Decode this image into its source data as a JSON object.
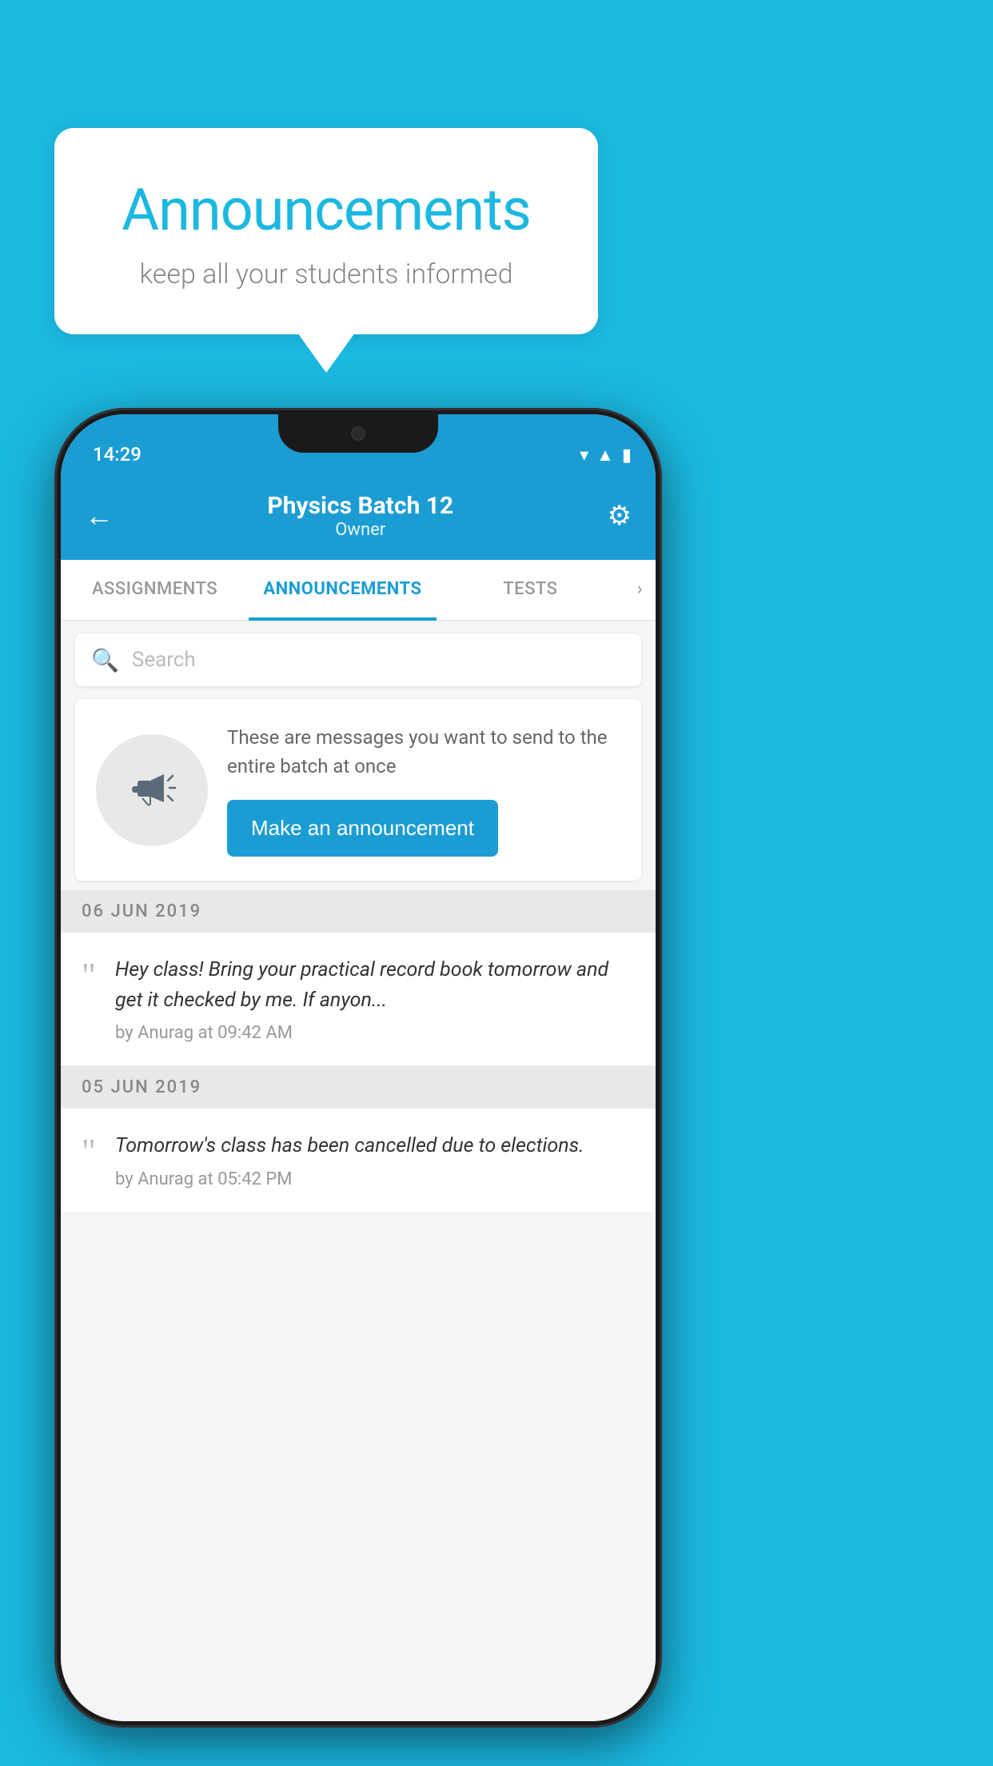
{
  "background_color": "#1bb8e0",
  "speech_bubble": {
    "title": "Announcements",
    "subtitle": "keep all your students informed"
  },
  "phone": {
    "status_bar": {
      "time": "14:29"
    },
    "header": {
      "back_label": "←",
      "batch_name": "Physics Batch 12",
      "owner_label": "Owner",
      "gear_label": "⚙"
    },
    "tabs": [
      {
        "label": "ASSIGNMENTS",
        "active": false
      },
      {
        "label": "ANNOUNCEMENTS",
        "active": true
      },
      {
        "label": "TESTS",
        "active": false
      },
      {
        "label": "›",
        "active": false
      }
    ],
    "search": {
      "placeholder": "Search"
    },
    "promo_section": {
      "description": "These are messages you want to send to the entire batch at once",
      "button_label": "Make an announcement"
    },
    "announcements": [
      {
        "date": "06  JUN  2019",
        "text": "Hey class! Bring your practical record book tomorrow and get it checked by me. If anyon...",
        "meta": "by Anurag at 09:42 AM"
      },
      {
        "date": "05  JUN  2019",
        "text": "Tomorrow's class has been cancelled due to elections.",
        "meta": "by Anurag at 05:42 PM"
      }
    ]
  }
}
